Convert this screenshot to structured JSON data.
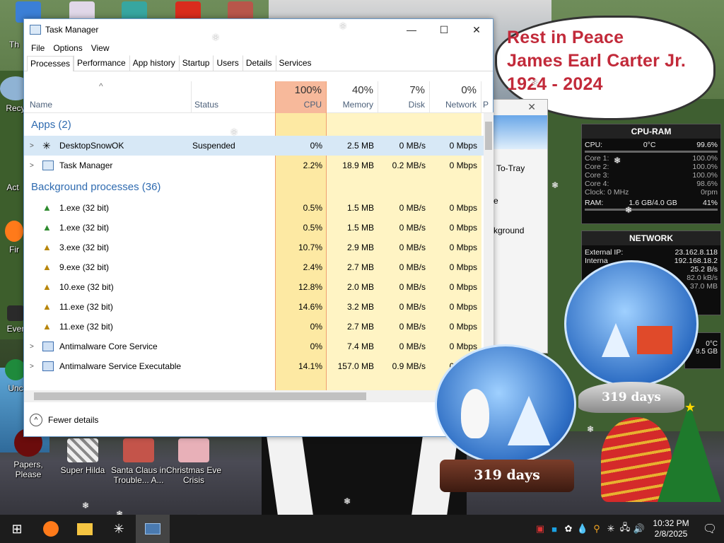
{
  "desktop": {
    "top_icons": [
      {
        "label": "Th",
        "icon": "app-icon"
      },
      {
        "label": "",
        "icon": "app-icon"
      },
      {
        "label": "",
        "icon": "app-icon"
      },
      {
        "label": "",
        "icon": "mcdonalds-icon"
      },
      {
        "label": "",
        "icon": "christmas-icon"
      }
    ],
    "left_icons": [
      {
        "label": "Recy",
        "icon": "recycle-bin-icon"
      },
      {
        "label": "Act",
        "icon": "app-icon"
      },
      {
        "label": "Fir",
        "icon": "firefox-icon"
      },
      {
        "label": "Ever",
        "icon": "app-icon"
      },
      {
        "label": "Unc",
        "icon": "app-icon"
      }
    ],
    "bottom_icons": [
      {
        "label": "Papers, Please",
        "icon": "papers-please-icon"
      },
      {
        "label": "Super Hilda",
        "icon": "super-hilda-icon"
      },
      {
        "label": "Santa Claus in Trouble... A...",
        "icon": "santa-claus-icon"
      },
      {
        "label": "Christmas Eve Crisis",
        "icon": "christmas-eve-icon"
      }
    ],
    "rip_banner": [
      "Rest in Peace",
      "James Earl Carter Jr.",
      "1924 - 2024"
    ]
  },
  "cpu_ram_gadget": {
    "title": "CPU-RAM",
    "cpu_label": "CPU:",
    "cpu_temp": "0°C",
    "cpu_value": "99.6%",
    "cores": [
      {
        "label": "Core 1:",
        "value": "100.0%"
      },
      {
        "label": "Core 2:",
        "value": "100.0%"
      },
      {
        "label": "Core 3:",
        "value": "100.0%"
      },
      {
        "label": "Core 4:",
        "value": "98.6%"
      }
    ],
    "clock_label": "Clock: 0 MHz",
    "clock_fan": "0rpm",
    "ram_label": "RAM:",
    "ram_used": "1.6 GB/4.0 GB",
    "ram_pct": "41%"
  },
  "network_gadget": {
    "title": "NETWORK",
    "external_ip_label": "External IP:",
    "external_ip": "23.162.8.118",
    "internal_label": "Interna",
    "internal_ip": "192.168.18.2",
    "speed1": "25.2 B/s",
    "speed2": "82.0 kB/s",
    "speed3": "37.0 MB"
  },
  "extra_gadget": {
    "temp": "0°C",
    "size": "9.5 GB"
  },
  "snow_globes": [
    {
      "days": "319 days"
    },
    {
      "days": "319 days"
    }
  ],
  "task_manager": {
    "title": "Task Manager",
    "window_buttons": {
      "minimize": "—",
      "maximize": "☐",
      "close": "✕"
    },
    "menu": [
      "File",
      "Options",
      "View"
    ],
    "tabs": [
      "Processes",
      "Performance",
      "App history",
      "Startup",
      "Users",
      "Details",
      "Services"
    ],
    "active_tab": "Processes",
    "columns": {
      "name": "Name",
      "status": "Status",
      "cpu": {
        "pct": "100%",
        "label": "CPU"
      },
      "memory": {
        "pct": "40%",
        "label": "Memory"
      },
      "disk": {
        "pct": "7%",
        "label": "Disk"
      },
      "network": {
        "pct": "0%",
        "label": "Network"
      },
      "extra": "P"
    },
    "groups": [
      {
        "title": "Apps (2)",
        "rows": [
          {
            "expand": true,
            "name": "DesktopSnowOK",
            "status": "Suspended",
            "cpu": "0%",
            "mem": "2.5 MB",
            "disk": "0 MB/s",
            "net": "0 Mbps",
            "selected": true,
            "icon": "snowflake-icon"
          },
          {
            "expand": true,
            "name": "Task Manager",
            "status": "",
            "cpu": "2.2%",
            "mem": "18.9 MB",
            "disk": "0.2 MB/s",
            "net": "0 Mbps",
            "selected": false,
            "icon": "task-manager-icon"
          }
        ]
      },
      {
        "title": "Background processes (36)",
        "rows": [
          {
            "expand": false,
            "name": "1.exe (32 bit)",
            "status": "",
            "cpu": "0.5%",
            "mem": "1.5 MB",
            "disk": "0 MB/s",
            "net": "0 Mbps",
            "selected": false,
            "icon": "xmas-tree-icon"
          },
          {
            "expand": false,
            "name": "1.exe (32 bit)",
            "status": "",
            "cpu": "0.5%",
            "mem": "1.5 MB",
            "disk": "0 MB/s",
            "net": "0 Mbps",
            "selected": false,
            "icon": "xmas-tree-icon"
          },
          {
            "expand": false,
            "name": "3.exe (32 bit)",
            "status": "",
            "cpu": "10.7%",
            "mem": "2.9 MB",
            "disk": "0 MB/s",
            "net": "0 Mbps",
            "selected": false,
            "icon": "xmas-tree-icon"
          },
          {
            "expand": false,
            "name": "9.exe (32 bit)",
            "status": "",
            "cpu": "2.4%",
            "mem": "2.7 MB",
            "disk": "0 MB/s",
            "net": "0 Mbps",
            "selected": false,
            "icon": "xmas-tree-icon"
          },
          {
            "expand": false,
            "name": "10.exe (32 bit)",
            "status": "",
            "cpu": "12.8%",
            "mem": "2.0 MB",
            "disk": "0 MB/s",
            "net": "0 Mbps",
            "selected": false,
            "icon": "xmas-tree-icon"
          },
          {
            "expand": false,
            "name": "11.exe (32 bit)",
            "status": "",
            "cpu": "14.6%",
            "mem": "3.2 MB",
            "disk": "0 MB/s",
            "net": "0 Mbps",
            "selected": false,
            "icon": "xmas-tree-icon"
          },
          {
            "expand": false,
            "name": "11.exe (32 bit)",
            "status": "",
            "cpu": "0%",
            "mem": "2.7 MB",
            "disk": "0 MB/s",
            "net": "0 Mbps",
            "selected": false,
            "icon": "xmas-tree-icon"
          },
          {
            "expand": true,
            "name": "Antimalware Core Service",
            "status": "",
            "cpu": "0%",
            "mem": "7.4 MB",
            "disk": "0 MB/s",
            "net": "0 Mbps",
            "selected": false,
            "icon": "service-icon"
          },
          {
            "expand": true,
            "name": "Antimalware Service Executable",
            "status": "",
            "cpu": "14.1%",
            "mem": "157.0 MB",
            "disk": "0.9 MB/s",
            "net": "0 Mbps",
            "selected": false,
            "icon": "service-icon"
          }
        ]
      }
    ],
    "footer": "Fewer details"
  },
  "second_window": {
    "to_tray": "To-Tray",
    "e": "e",
    "background": "kground"
  },
  "taskbar": {
    "buttons": [
      "start-icon",
      "firefox-icon",
      "file-explorer-icon",
      "snowflake-icon",
      "task-manager-icon"
    ],
    "time": "10:32 PM",
    "date": "2/8/2025"
  },
  "colors": {
    "accent": "#2f6bb0",
    "cpu_header": "#f7b99b",
    "heat_light": "#fff4c4",
    "heat_mid": "#fde9a3",
    "selected_row": "#d7e8f6",
    "rip_text": "#c22a3a"
  }
}
